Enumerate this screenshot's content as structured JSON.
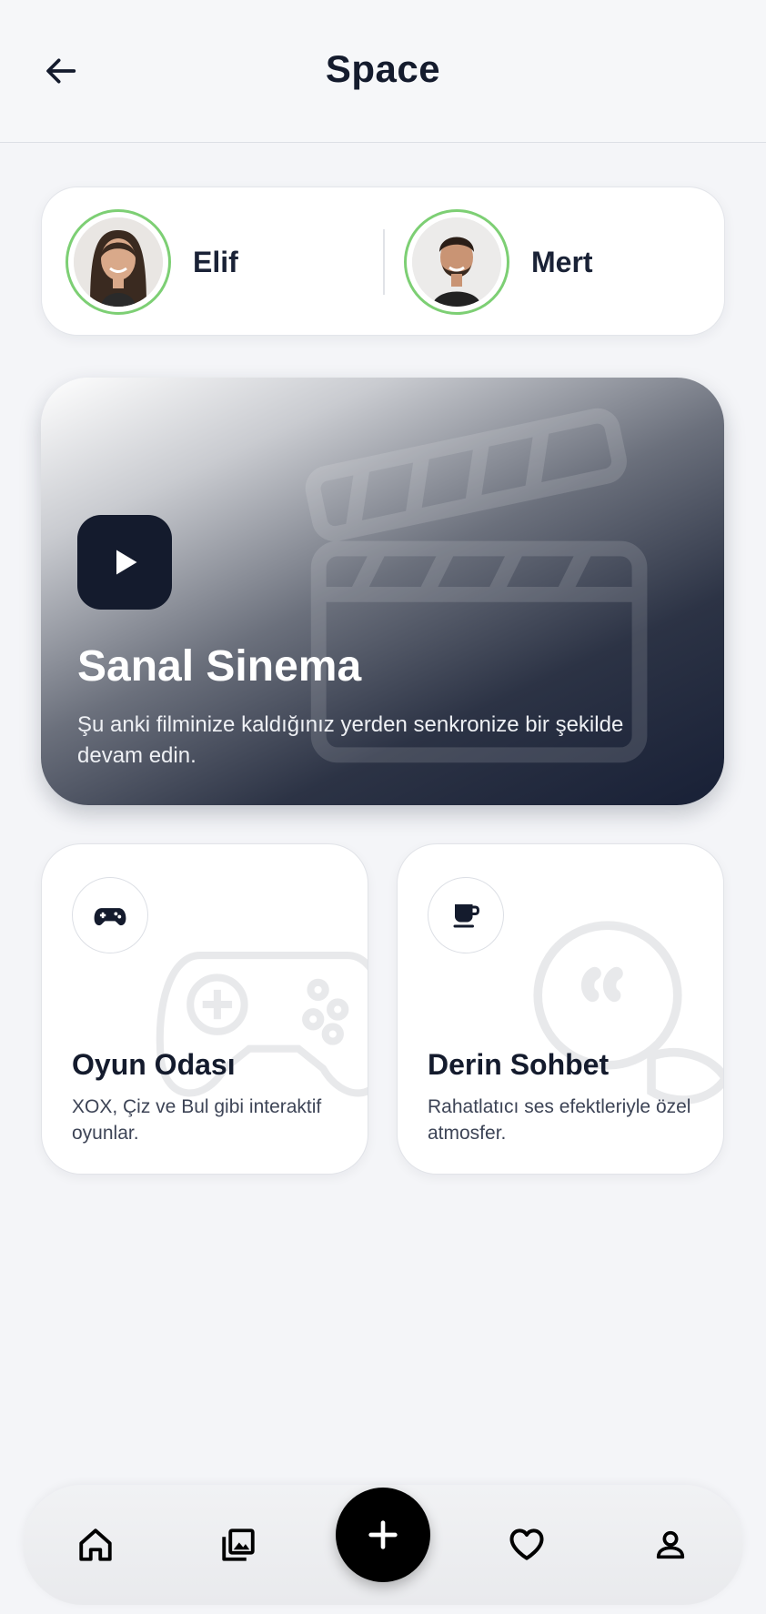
{
  "header": {
    "title": "Space",
    "back_icon": "arrow-left-icon"
  },
  "participants": [
    {
      "name": "Elif",
      "avatar": "female-portrait"
    },
    {
      "name": "Mert",
      "avatar": "male-portrait"
    }
  ],
  "status_ring_color": "#7dcf74",
  "cinema": {
    "title": "Sanal Sinema",
    "description": "Şu anki filminize kaldığınız yerden senkronize bir şekilde devam edin.",
    "play_icon": "play-icon",
    "background_icon": "clapperboard-icon"
  },
  "features": {
    "game": {
      "title": "Oyun Odası",
      "description": "XOX, Çiz ve Bul gibi interaktif oyunlar.",
      "icon": "gamepad-icon"
    },
    "chat": {
      "title": "Derin Sohbet",
      "description": "Rahatlatıcı ses efektleriyle özel atmosfer.",
      "icon": "coffee-cup-icon"
    }
  },
  "bottom_nav": {
    "items": [
      "home-icon",
      "gallery-icon",
      "add-icon",
      "heart-icon",
      "profile-icon"
    ]
  },
  "colors": {
    "primary_dark": "#141b2d",
    "background": "#f4f5f8"
  }
}
